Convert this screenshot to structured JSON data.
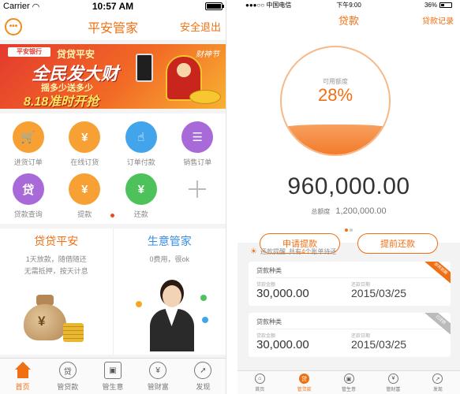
{
  "left": {
    "status_bar": {
      "carrier": "Carrier",
      "time": "10:57 AM",
      "battery_level": 1.0
    },
    "nav": {
      "title": "平安管家",
      "exit_label": "安全退出",
      "chat_icon": "chat-bubble-icon"
    },
    "banner": {
      "logo_text": "平安银行",
      "line1": "贷贷平安",
      "line2": "全民发大财",
      "line3": "摇多少送多少",
      "line4": "8.18准时开抢",
      "corner_text": "财神节"
    },
    "grid": [
      {
        "label": "进货订单",
        "icon": "cart-icon",
        "glyph": "🛒",
        "color": "#f7a134"
      },
      {
        "label": "在线订货",
        "icon": "phone-order-icon",
        "glyph": "¥",
        "color": "#f7a134"
      },
      {
        "label": "订单付款",
        "icon": "hand-pay-icon",
        "glyph": "☝",
        "color": "#42a5ec"
      },
      {
        "label": "销售订单",
        "icon": "document-icon",
        "glyph": "☰",
        "color": "#a86ad9"
      },
      {
        "label": "贷款查询",
        "icon": "loan-query-icon",
        "glyph": "贷",
        "color": "#a86ad9"
      },
      {
        "label": "提款",
        "icon": "withdraw-icon",
        "glyph": "¥",
        "color": "#f7a134"
      },
      {
        "label": "还款",
        "icon": "repay-icon",
        "glyph": "¥",
        "color": "#4ec25a"
      }
    ],
    "cards": [
      {
        "title": "贷贷平安",
        "title_color": "#f06f12",
        "sub1": "1天放款，随借随还",
        "sub2": "无需抵押，按天计息"
      },
      {
        "title": "生意管家",
        "title_color": "#3b8de0",
        "sub1": "0费用，很ok",
        "sub2": ""
      }
    ],
    "tabs": [
      {
        "label": "首页",
        "icon": "home-icon",
        "glyph": ""
      },
      {
        "label": "管贷款",
        "icon": "loan-icon",
        "glyph": "贷"
      },
      {
        "label": "管生意",
        "icon": "briefcase-icon",
        "glyph": "▣"
      },
      {
        "label": "管财富",
        "icon": "money-bag-icon",
        "glyph": "¥"
      },
      {
        "label": "发现",
        "icon": "compass-icon",
        "glyph": "➚"
      }
    ],
    "active_tab": 0
  },
  "right": {
    "status_bar": {
      "signal": "●●●○○",
      "carrier": "中国电信",
      "time": "下午9:00",
      "battery": "36%",
      "battery_level": 0.36
    },
    "nav": {
      "title": "贷款",
      "record_label": "贷款记录"
    },
    "gauge": {
      "label": "可用额度",
      "value": "28%",
      "fill_fraction": 0.28
    },
    "available": "960,000.00",
    "total_label": "总额度",
    "total": "1,200,000.00",
    "buttons": {
      "apply": "申请提款",
      "repay": "提前还款"
    },
    "reminder": {
      "label": "还款提醒",
      "count_prefix": "共有",
      "count": "4",
      "count_suffix": "个账单待还"
    },
    "loans": [
      {
        "type": "贷款种类",
        "amount_label": "贷款金额",
        "amount": "30,000.00",
        "date_label": "还款日期",
        "date": "2015/03/25",
        "ribbon": "即将到期",
        "ribbon_color": "#f06f12"
      },
      {
        "type": "贷款种类",
        "amount_label": "贷款金额",
        "amount": "30,000.00",
        "date_label": "还款日期",
        "date": "2015/03/25",
        "ribbon": "已还款",
        "ribbon_color": "#bbbbbb"
      }
    ],
    "tabs": [
      {
        "label": "首页",
        "icon": "home-icon",
        "glyph": "⌂"
      },
      {
        "label": "管贷款",
        "icon": "loan-icon",
        "glyph": "贷"
      },
      {
        "label": "管生意",
        "icon": "briefcase-icon",
        "glyph": "▣"
      },
      {
        "label": "管财富",
        "icon": "money-bag-icon",
        "glyph": "¥"
      },
      {
        "label": "发现",
        "icon": "compass-icon",
        "glyph": "➚"
      }
    ],
    "active_tab": 1
  }
}
